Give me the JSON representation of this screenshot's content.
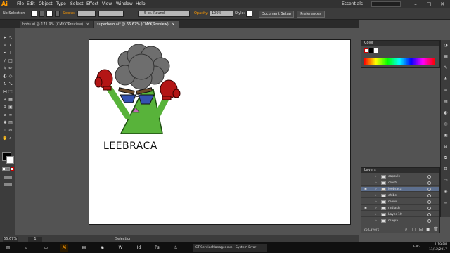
{
  "menubar": {
    "logo": "Ai",
    "items": [
      "File",
      "Edit",
      "Object",
      "Type",
      "Select",
      "Effect",
      "View",
      "Window",
      "Help"
    ],
    "workspace": "Essentials",
    "window_buttons": [
      "–",
      "□",
      "✕"
    ]
  },
  "control": {
    "selection_label": "No Selection",
    "stroke_label": "Stroke:",
    "brush_label": "5 pt. Round",
    "opacity_label": "Opacity:",
    "opacity_value": "100%",
    "style_label": "Style:",
    "document_setup": "Document Setup",
    "preferences": "Preferences"
  },
  "tabs": [
    {
      "label": "hobs.ai @ 171.9% (CMYK/Preview)",
      "close": "×"
    },
    {
      "label": "superhero.ai* @ 66.67% (CMYK/Preview)",
      "close": "×"
    }
  ],
  "artwork": {
    "character_name": "LEEBRACA",
    "colors": {
      "hair": "#6e6e6e",
      "hair_outline": "#333333",
      "body": "#58b33a",
      "body_outline": "#1c4d10",
      "gloves": "#b31515",
      "glasses": "#3552b0",
      "eyebrows": "#6b4a2a",
      "nose": "#c26bb5"
    }
  },
  "color_panel": {
    "title": "Color"
  },
  "layers_panel": {
    "title": "Layers",
    "layers": [
      {
        "name": "capsule",
        "selected": false,
        "visible": false
      },
      {
        "name": "crosti",
        "selected": false,
        "visible": false
      },
      {
        "name": "leebraca",
        "selected": true,
        "visible": true
      },
      {
        "name": "chibe",
        "selected": false,
        "visible": false
      },
      {
        "name": "mews",
        "selected": false,
        "visible": false
      },
      {
        "name": "radiash",
        "selected": false,
        "visible": true
      },
      {
        "name": "Layer 10",
        "selected": false,
        "visible": false
      },
      {
        "name": "magia",
        "selected": false,
        "visible": false
      }
    ],
    "footer": "25 Layers"
  },
  "statusbar": {
    "zoom": "66.67%",
    "mode": "Selection"
  },
  "taskbar": {
    "items": [
      {
        "icon": "windows-icon",
        "glyph": "⊞"
      },
      {
        "icon": "search-icon",
        "glyph": "⌕"
      },
      {
        "icon": "task-view-icon",
        "glyph": "▭"
      },
      {
        "icon": "illustrator-icon",
        "glyph": "Ai"
      },
      {
        "icon": "file-explorer-icon",
        "glyph": "▤"
      },
      {
        "icon": "chrome-icon",
        "glyph": "◉"
      },
      {
        "icon": "word-icon",
        "glyph": "W"
      },
      {
        "icon": "indesign-icon",
        "glyph": "Id"
      },
      {
        "icon": "photoshop-icon",
        "glyph": "Ps"
      },
      {
        "icon": "system-error-icon",
        "glyph": "⚠"
      }
    ],
    "error_window": "CTIServiceManager.exe - System Error",
    "language": "ENG",
    "time": "1:19 PM",
    "date": "11/12/2017"
  }
}
